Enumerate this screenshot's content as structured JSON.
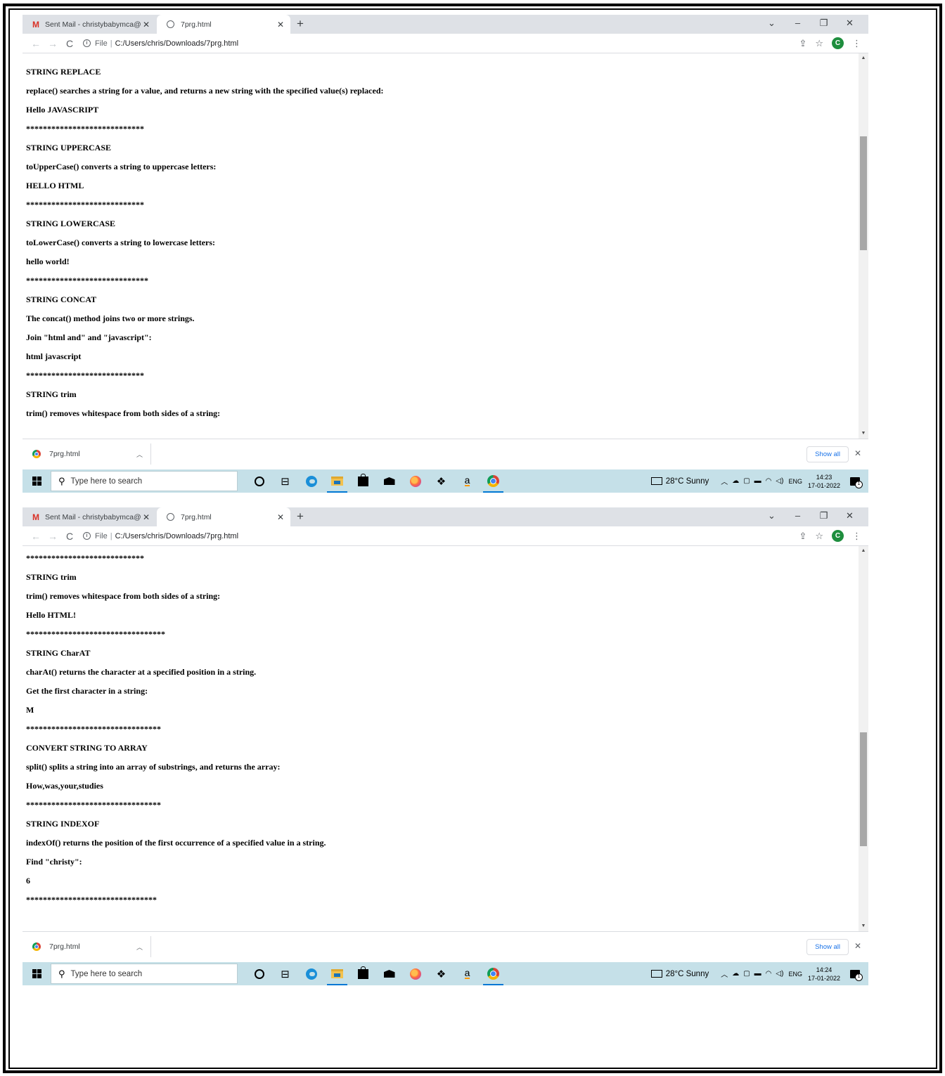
{
  "screens": [
    {
      "browser": {
        "tabs": [
          "Sent Mail - christybabymca@gm",
          "7prg.html"
        ],
        "url_scheme": "File",
        "url_path": "C:/Users/chris/Downloads/7prg.html",
        "profile_initial": "C"
      },
      "page_lines": [
        "*****************************",
        "STRING REPLACE",
        "replace() searches a string for a value, and returns a new string with the specified value(s) replaced:",
        "Hello JAVASCRIPT",
        "****************************",
        "STRING UPPERCASE",
        "toUpperCase() converts a string to uppercase letters:",
        "HELLO HTML",
        "****************************",
        "STRING LOWERCASE",
        "toLowerCase() converts a string to lowercase letters:",
        "hello world!",
        "*****************************",
        "STRING CONCAT",
        "The concat() method joins two or more strings.",
        "Join \"html and\" and \"javascript\":",
        "html javascript",
        "****************************",
        "STRING trim",
        "trim() removes whitespace from both sides of a string:"
      ],
      "scroll_position": 0.29,
      "download": {
        "file": "7prg.html",
        "show_all": "Show all"
      },
      "taskbar": {
        "search_placeholder": "Type here to search",
        "weather": "28°C  Sunny",
        "lang": "ENG",
        "time": "14:23",
        "date": "17-01-2022"
      }
    },
    {
      "browser": {
        "tabs": [
          "Sent Mail - christybabymca@gm",
          "7prg.html"
        ],
        "url_scheme": "File",
        "url_path": "C:/Users/chris/Downloads/7prg.html",
        "profile_initial": "C"
      },
      "page_lines": [
        "****************************",
        "STRING trim",
        "trim() removes whitespace from both sides of a string:",
        "Hello HTML!",
        "*********************************",
        "STRING CharAT",
        "charAt() returns the character at a specified position in a string.",
        "Get the first character in a string:",
        "M",
        "********************************",
        "CONVERT STRING TO ARRAY",
        "split() splits a string into an array of substrings, and returns the array:",
        "How,was,your,studies",
        "********************************",
        "STRING INDEXOF",
        "indexOf() returns the position of the first occurrence of a specified value in a string.",
        "Find \"christy\":",
        "6",
        "*******************************"
      ],
      "scroll_position": 0.7,
      "download": {
        "file": "7prg.html",
        "show_all": "Show all"
      },
      "taskbar": {
        "search_placeholder": "Type here to search",
        "weather": "28°C  Sunny",
        "lang": "ENG",
        "time": "14:24",
        "date": "17-01-2022"
      }
    }
  ]
}
